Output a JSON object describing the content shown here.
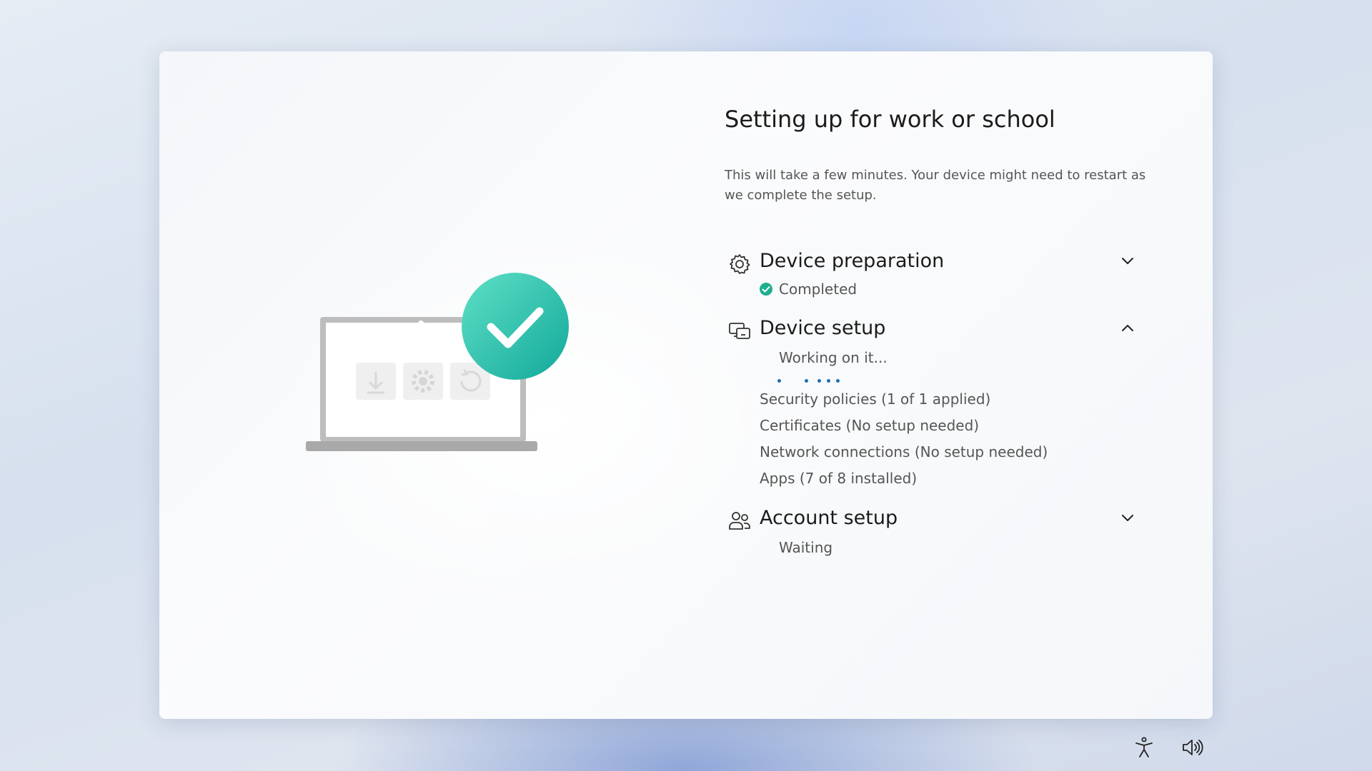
{
  "page": {
    "title": "Setting up for work or school",
    "description": "This will take a few minutes. Your device might need to restart as we complete the setup."
  },
  "sections": [
    {
      "title": "Device preparation",
      "status": "Completed",
      "icon": "gear-icon",
      "expanded": false
    },
    {
      "title": "Device setup",
      "status": "Working on it...",
      "icon": "device-setup-icon",
      "expanded": true,
      "items": [
        "Security policies (1 of 1 applied)",
        "Certificates (No setup needed)",
        "Network connections (No setup needed)",
        "Apps (7 of 8 installed)"
      ]
    },
    {
      "title": "Account setup",
      "status": "Waiting",
      "icon": "people-icon",
      "expanded": false
    }
  ],
  "colors": {
    "accent": "#1f6fb2",
    "success": "#1fae8e"
  },
  "bottom_icons": [
    "accessibility-icon",
    "volume-icon"
  ]
}
